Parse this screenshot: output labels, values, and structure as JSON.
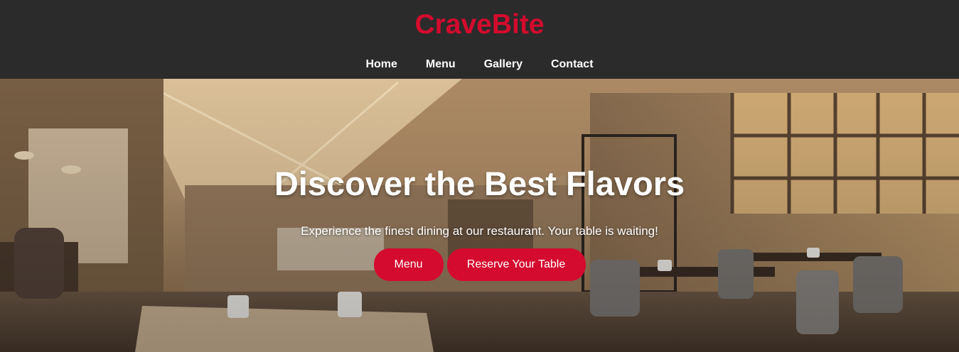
{
  "brand": {
    "name": "CraveBite",
    "color": "#d40b2e"
  },
  "nav": {
    "items": [
      {
        "label": "Home"
      },
      {
        "label": "Menu"
      },
      {
        "label": "Gallery"
      },
      {
        "label": "Contact"
      }
    ]
  },
  "hero": {
    "title": "Discover the Best Flavors",
    "subtitle": "Experience the finest dining at our restaurant. Your table is waiting!",
    "buttons": {
      "menu": "Menu",
      "reserve": "Reserve Your Table"
    },
    "image": "restaurant-interior-photo"
  },
  "colors": {
    "header_bg": "#2b2b2b",
    "accent": "#d40b2e",
    "text": "#ffffff"
  }
}
